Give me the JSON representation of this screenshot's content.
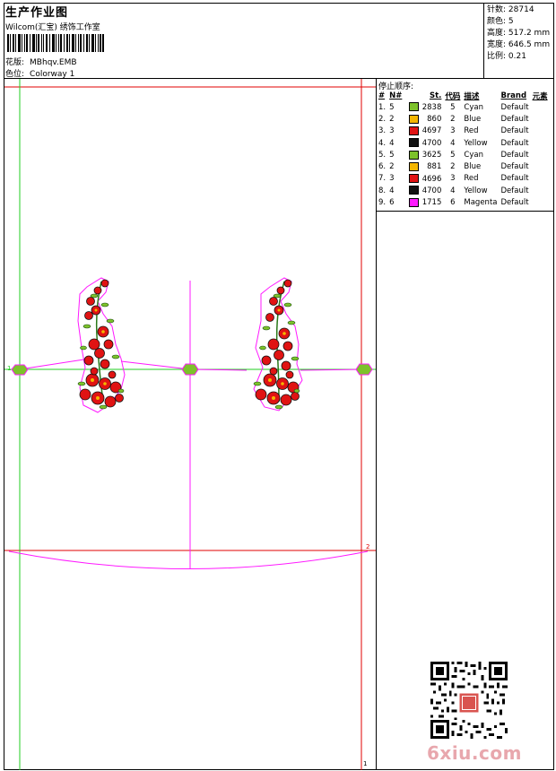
{
  "header": {
    "title": "生产作业图",
    "company": "Wilcom(汇宝) 绣饰工作室",
    "design_label": "花版:",
    "design_value": "MBhqv.EMB",
    "colorway_label": "色位:",
    "colorway_value": "Colorway 1"
  },
  "stats": [
    {
      "label": "针数:",
      "value": "28714"
    },
    {
      "label": "颜色:",
      "value": "5"
    },
    {
      "label": "高度:",
      "value": "517.2 mm"
    },
    {
      "label": "宽度:",
      "value": "646.5 mm"
    },
    {
      "label": "比例:",
      "value": "0.21"
    }
  ],
  "sequence": {
    "title": "停止顺序:",
    "headers": [
      "#",
      "N#",
      "St.",
      "代码",
      "描述",
      "Brand",
      "元素"
    ],
    "rows": [
      {
        "idx": "1.",
        "n": "5",
        "color": "#7dc22b",
        "st": "2838",
        "code": "5",
        "desc": "Cyan",
        "brand": "Default"
      },
      {
        "idx": "2.",
        "n": "2",
        "color": "#f4b600",
        "st": "860",
        "code": "2",
        "desc": "Blue",
        "brand": "Default"
      },
      {
        "idx": "3.",
        "n": "3",
        "color": "#e01313",
        "st": "4697",
        "code": "3",
        "desc": "Red",
        "brand": "Default"
      },
      {
        "idx": "4.",
        "n": "4",
        "color": "#111111",
        "st": "4700",
        "code": "4",
        "desc": "Yellow",
        "brand": "Default"
      },
      {
        "idx": "5.",
        "n": "5",
        "color": "#7dc22b",
        "st": "3625",
        "code": "5",
        "desc": "Cyan",
        "brand": "Default"
      },
      {
        "idx": "6.",
        "n": "2",
        "color": "#f4b600",
        "st": "881",
        "code": "2",
        "desc": "Blue",
        "brand": "Default"
      },
      {
        "idx": "7.",
        "n": "3",
        "color": "#e01313",
        "st": "4696",
        "code": "3",
        "desc": "Red",
        "brand": "Default"
      },
      {
        "idx": "8.",
        "n": "4",
        "color": "#111111",
        "st": "4700",
        "code": "4",
        "desc": "Yellow",
        "brand": "Default"
      },
      {
        "idx": "9.",
        "n": "6",
        "color": "#ff19ff",
        "st": "1715",
        "code": "6",
        "desc": "Magenta",
        "brand": "Default"
      }
    ]
  },
  "canvas": {
    "marker_1": "1",
    "marker_2": "2",
    "marker_bottom": "1"
  },
  "watermark": "6xiu.com"
}
